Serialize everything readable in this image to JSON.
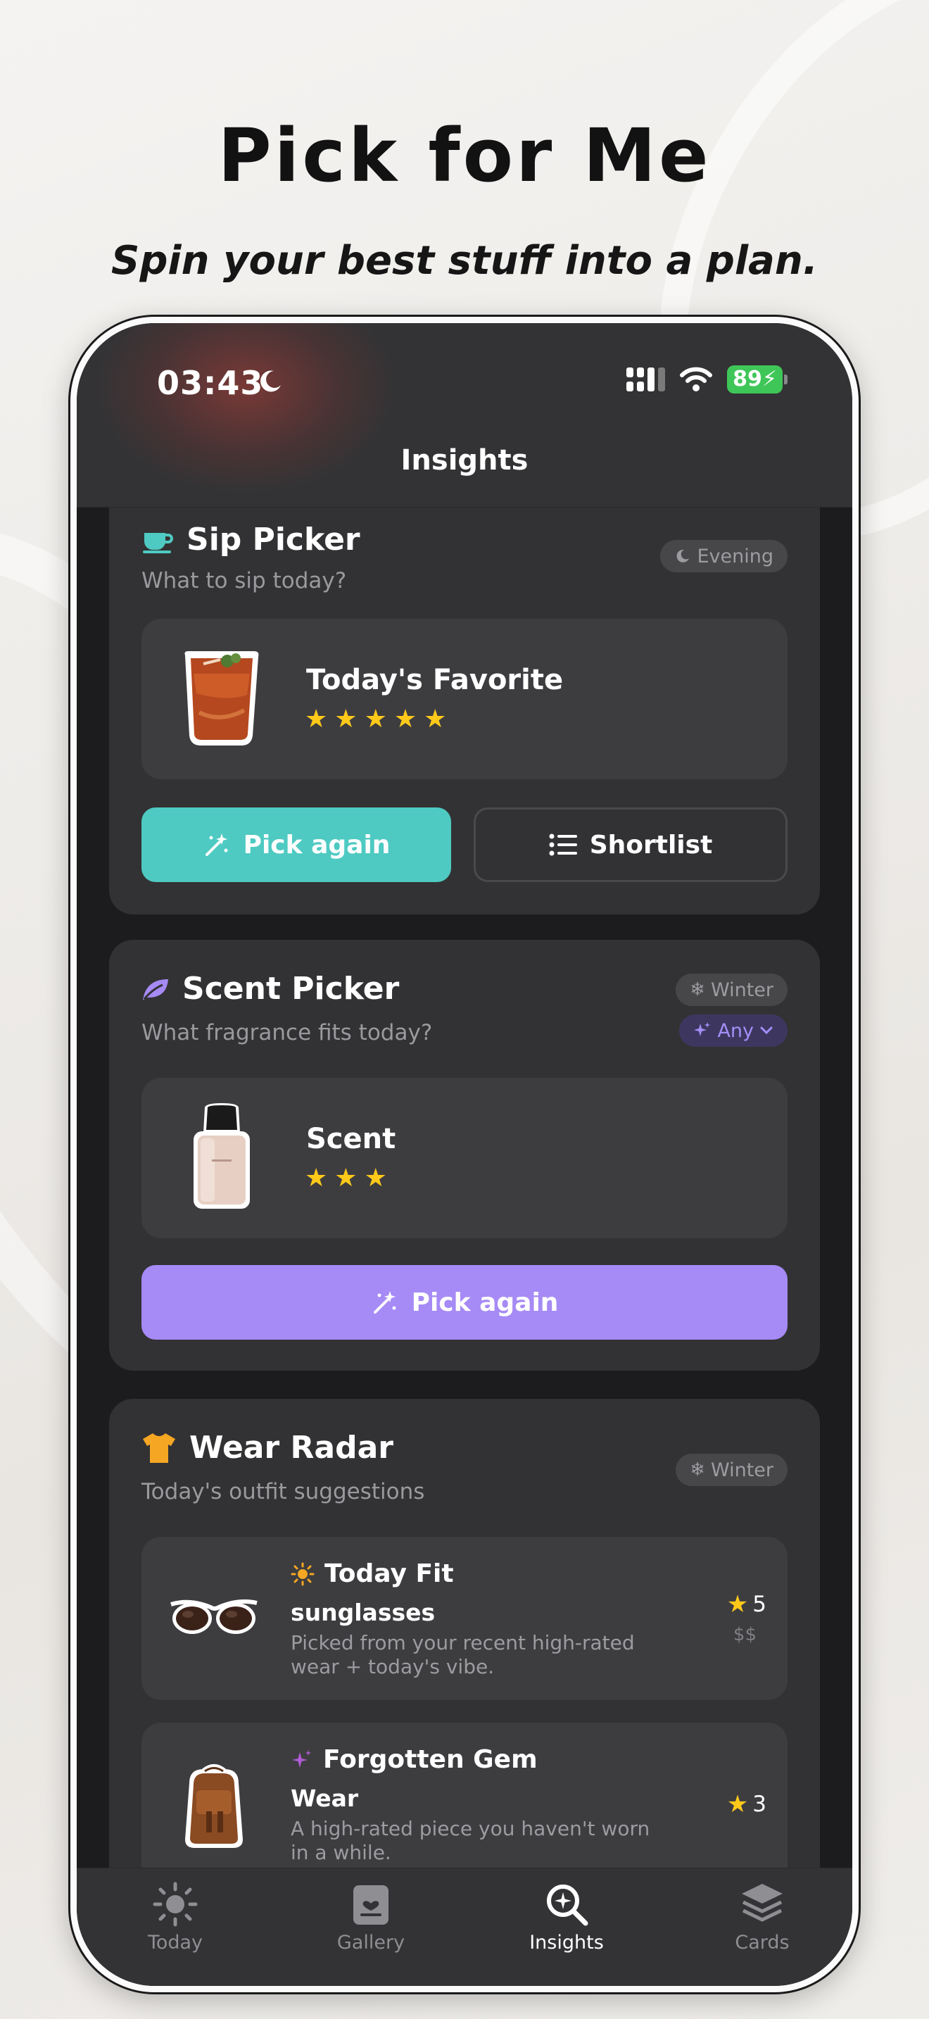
{
  "promo": {
    "title": "Pick for Me",
    "subtitle": "Spin your best stuff into a plan."
  },
  "status_bar": {
    "time": "03:43",
    "battery": "89"
  },
  "nav": {
    "title": "Insights"
  },
  "sip_picker": {
    "title": "Sip Picker",
    "subtitle": "What to sip today?",
    "badge": "Evening",
    "item_title": "Today's Favorite",
    "item_rating": 5,
    "pick_again_label": "Pick again",
    "shortlist_label": "Shortlist",
    "accent": "#4ecac2"
  },
  "scent_picker": {
    "title": "Scent Picker",
    "subtitle": "What fragrance fits today?",
    "season_badge": "Winter",
    "filter_label": "Any",
    "item_title": "Scent",
    "item_rating": 3,
    "pick_again_label": "Pick again",
    "accent": "#a68af5"
  },
  "wear_radar": {
    "title": "Wear Radar",
    "subtitle": "Today's outfit suggestions",
    "season_badge": "Winter",
    "rows": [
      {
        "label": "Today Fit",
        "name": "sunglasses",
        "description": "Picked from your recent high-rated wear + today's vibe.",
        "rating": "5",
        "price": "$$"
      },
      {
        "label": "Forgotten Gem",
        "name": "Wear",
        "description": "A high-rated piece you haven't worn in a while.",
        "rating": "3"
      }
    ]
  },
  "tabs": [
    {
      "label": "Today",
      "icon": "sun-icon"
    },
    {
      "label": "Gallery",
      "icon": "gallery-icon"
    },
    {
      "label": "Insights",
      "icon": "insights-search-icon",
      "active": true
    },
    {
      "label": "Cards",
      "icon": "cards-stack-icon"
    }
  ]
}
